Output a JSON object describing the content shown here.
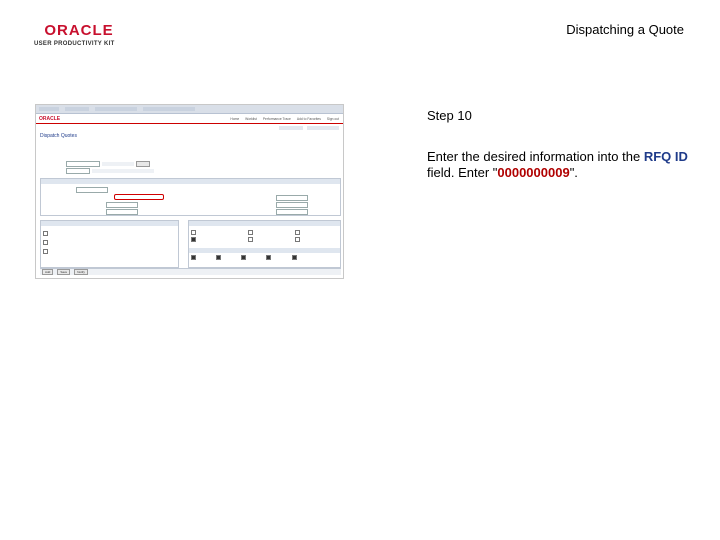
{
  "header": {
    "logo_name": "ORACLE",
    "logo_subtitle": "USER PRODUCTIVITY KIT",
    "slide_title": "Dispatching a Quote"
  },
  "step": {
    "label": "Step 10"
  },
  "instruction": {
    "prefix": "Enter the desired information into the",
    "field_name": "RFQ ID",
    "middle": "field. Enter \"",
    "value": "0000000009",
    "suffix": "\"."
  },
  "screenshot": {
    "page_title": "Dispatch Quotes",
    "menu": [
      "Home",
      "Worklist",
      "Performance Trace",
      "Add to Favorites",
      "Sign out"
    ],
    "bottom_buttons": [
      "Add",
      "Save",
      "Notify"
    ],
    "highlighted_field": "RFQ ID"
  },
  "colors": {
    "field_highlight": "#d00000",
    "field_name_text": "#1f3b8a",
    "value_text": "#b00000"
  }
}
